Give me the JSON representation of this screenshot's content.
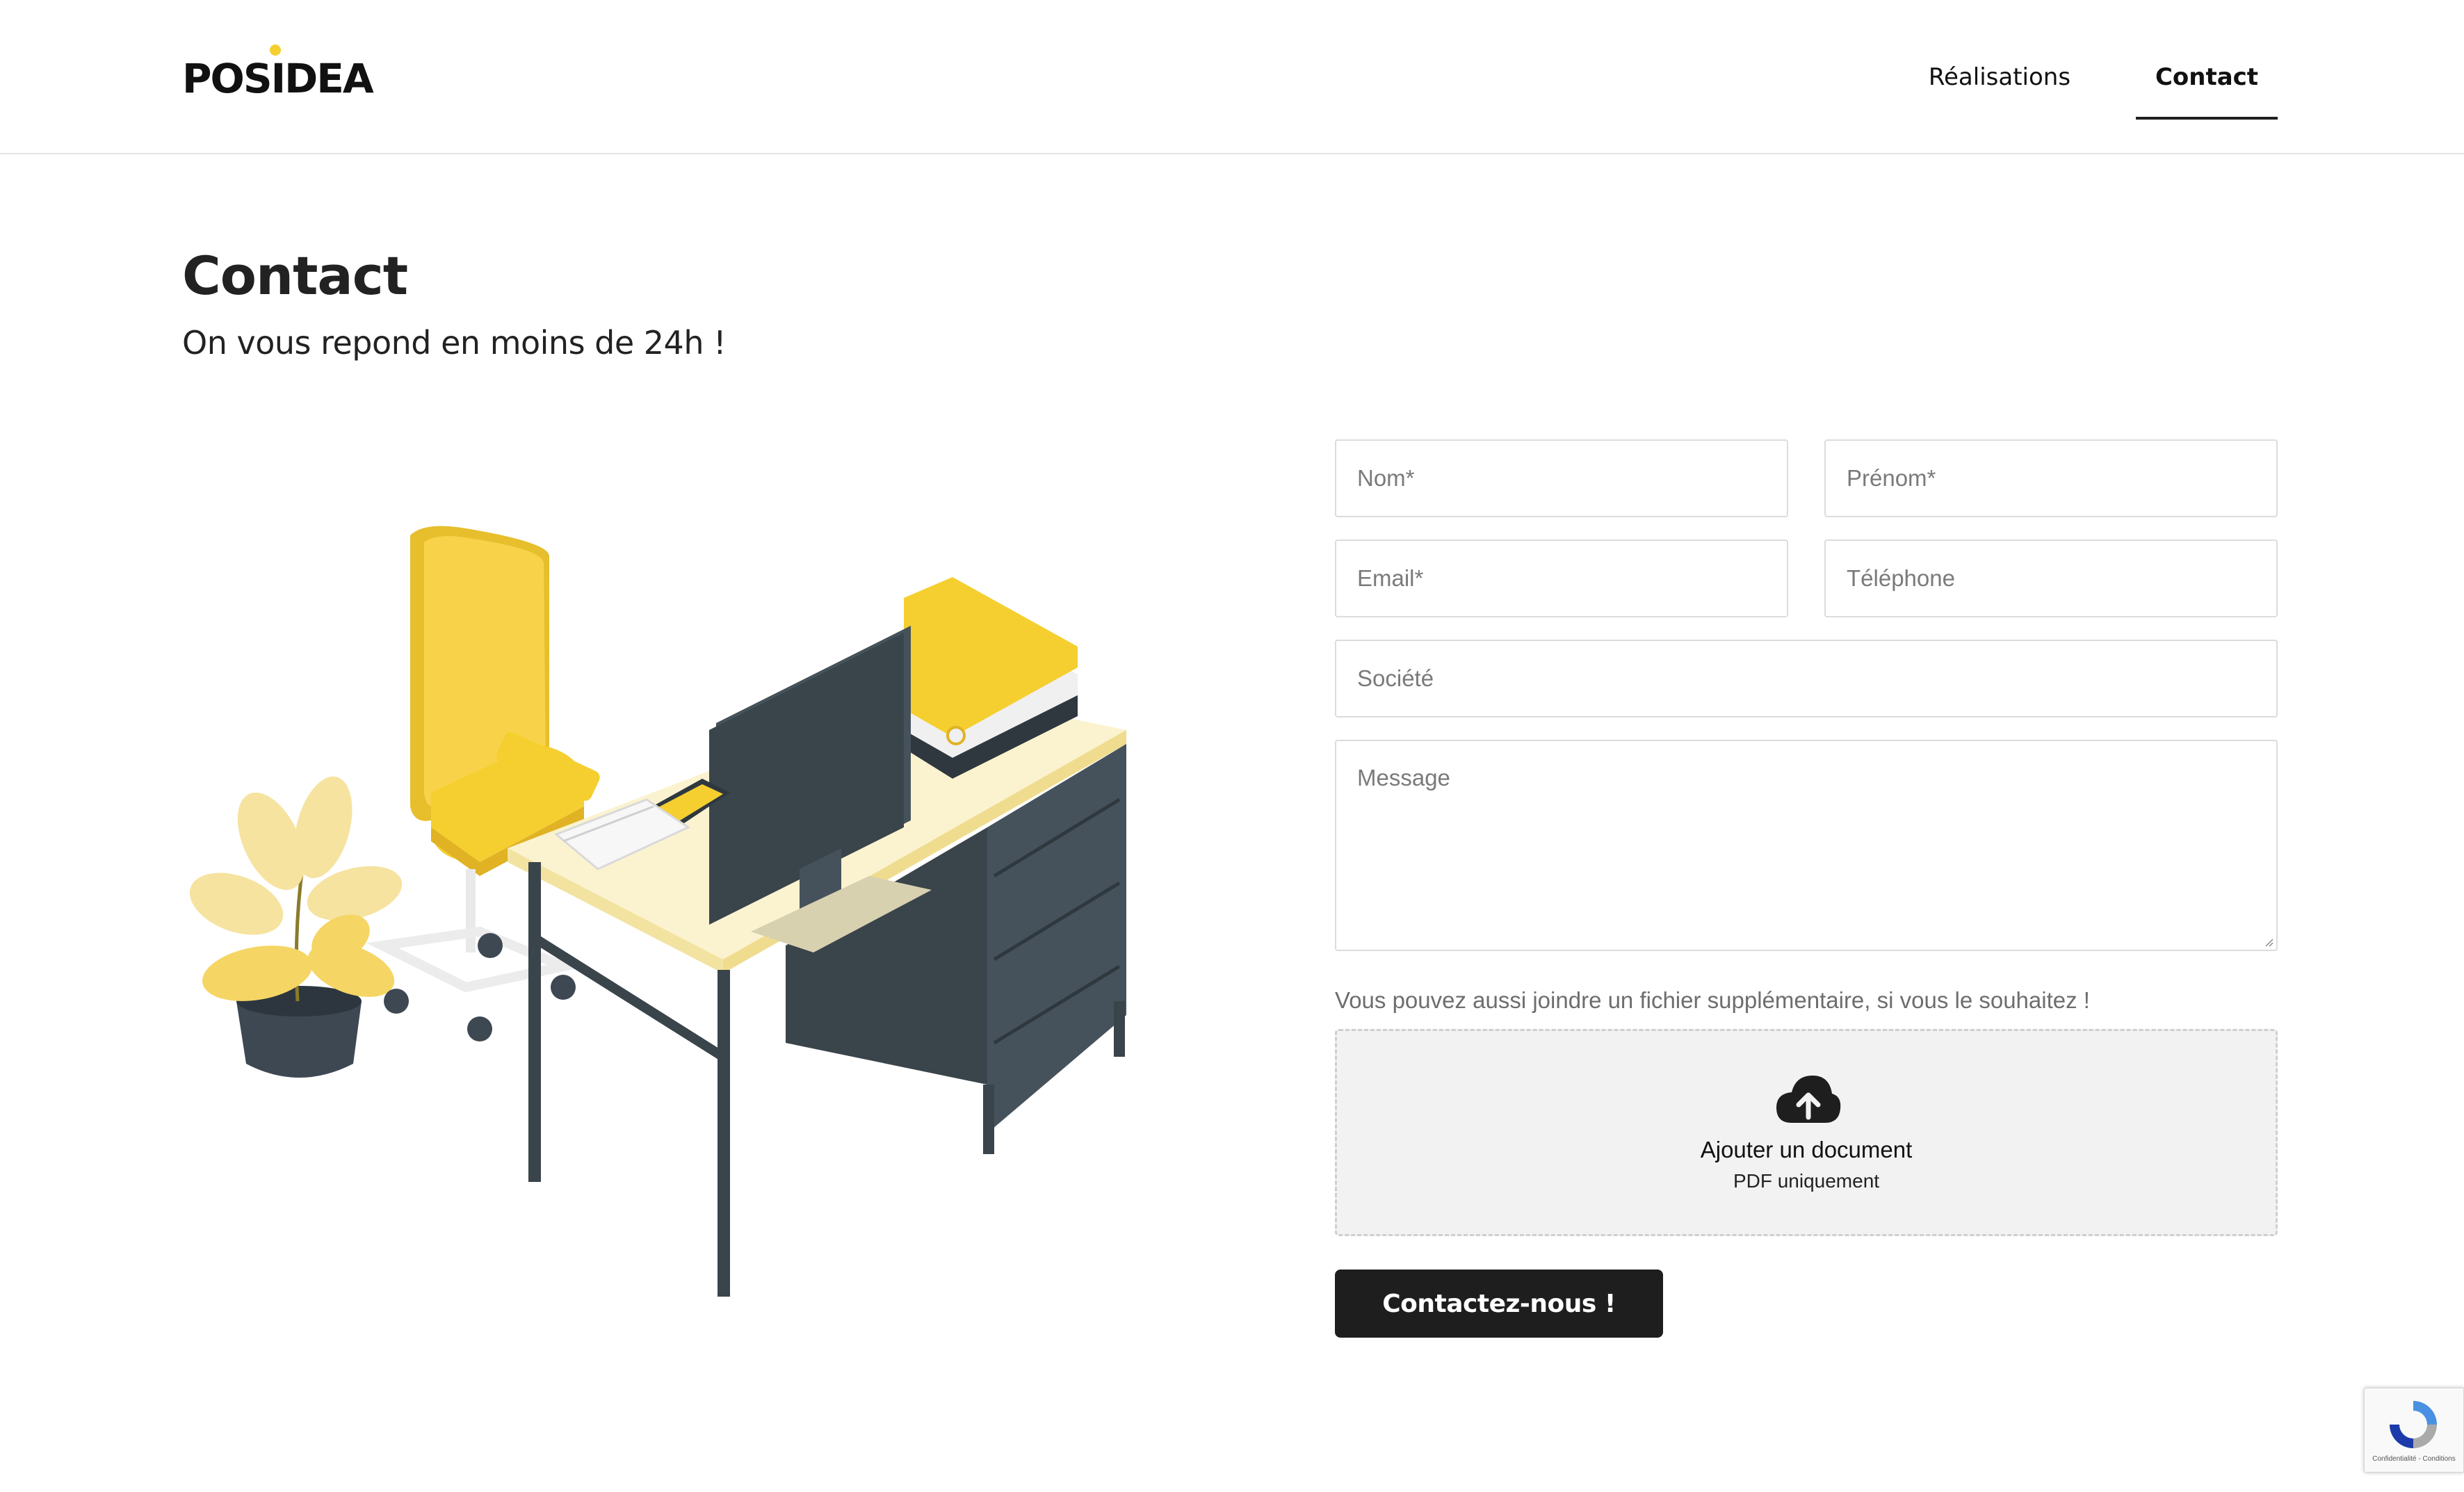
{
  "header": {
    "logo": "POSIDEA",
    "nav": [
      {
        "label": "Réalisations"
      },
      {
        "label": "Contact",
        "active": true
      }
    ]
  },
  "page": {
    "title": "Contact",
    "subtitle": "On vous repond en moins de 24h !"
  },
  "form": {
    "nom_placeholder": "Nom*",
    "prenom_placeholder": "Prénom*",
    "email_placeholder": "Email*",
    "telephone_placeholder": "Téléphone",
    "societe_placeholder": "Société",
    "message_placeholder": "Message",
    "attachment_hint": "Vous pouvez aussi joindre un fichier supplémentaire, si vous le souhaitez !",
    "upload_title": "Ajouter un document",
    "upload_subtitle": "PDF uniquement",
    "submit_label": "Contactez-nous !"
  },
  "recaptcha": {
    "links": "Confidentialité - Conditions"
  },
  "colors": {
    "accent": "#f5cf2f",
    "dark": "#1e1e1e",
    "desk": "#3f4a52",
    "desktop": "#fbf3cf"
  }
}
